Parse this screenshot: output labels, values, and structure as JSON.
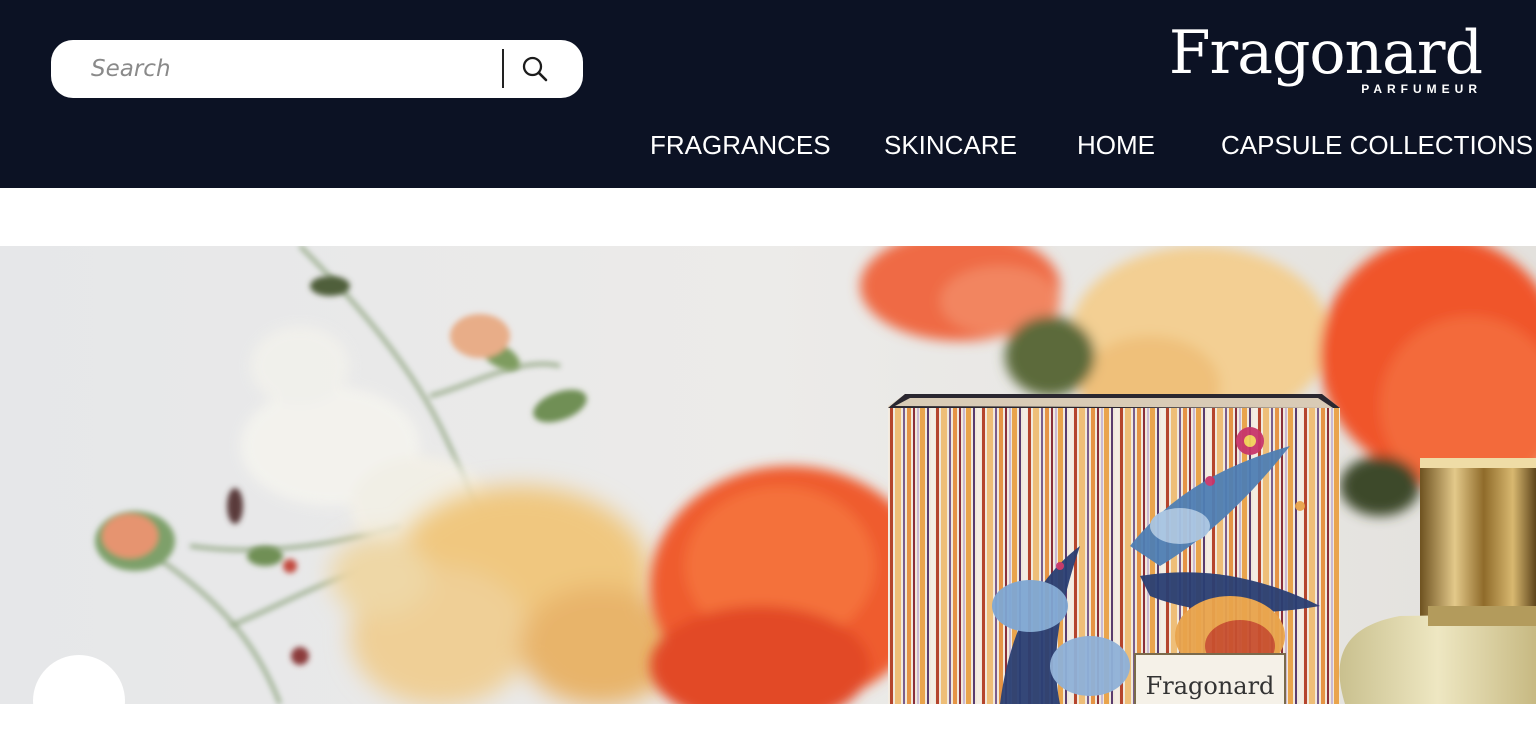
{
  "search": {
    "placeholder": "Search",
    "icon": "search-icon"
  },
  "brand": {
    "name": "Fragonard",
    "subtitle": "PARFUMEUR"
  },
  "nav": {
    "items": [
      {
        "label": "FRAGRANCES"
      },
      {
        "label": "SKINCARE"
      },
      {
        "label": "HOME"
      },
      {
        "label": "CAPSULE COLLECTIONS"
      }
    ]
  },
  "hero": {
    "box_label": "Fragonard"
  },
  "colors": {
    "header_bg": "#0c1224",
    "text_light": "#ffffff",
    "accent_orange": "#f0552a"
  }
}
